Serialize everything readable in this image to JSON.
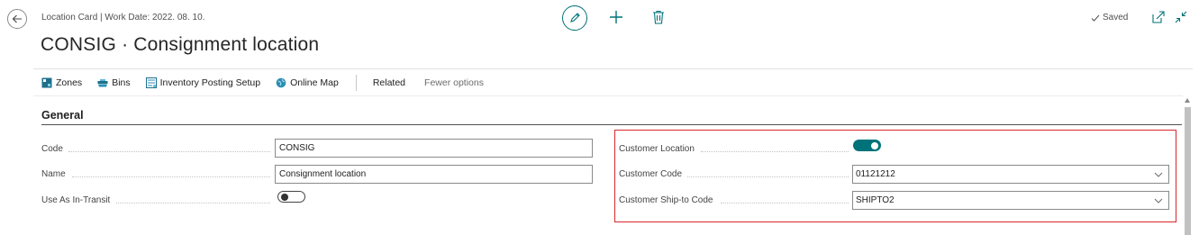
{
  "header": {
    "breadcrumb": "Location Card | Work Date: 2022. 08. 10.",
    "title": "CONSIG · Consignment location",
    "saved_label": "Saved"
  },
  "actions": [
    {
      "label": "Zones",
      "icon": "zones-icon"
    },
    {
      "label": "Bins",
      "icon": "bins-icon"
    },
    {
      "label": "Inventory Posting Setup",
      "icon": "inventory-posting-setup-icon"
    },
    {
      "label": "Online Map",
      "icon": "online-map-icon"
    }
  ],
  "action_related": "Related",
  "action_fewer": "Fewer options",
  "section": {
    "title": "General"
  },
  "fields": {
    "code": {
      "label": "Code",
      "value": "CONSIG"
    },
    "name": {
      "label": "Name",
      "value": "Consignment location"
    },
    "use_as_in_transit": {
      "label": "Use As In-Transit",
      "value": false
    },
    "customer_location": {
      "label": "Customer Location",
      "value": true
    },
    "customer_code": {
      "label": "Customer Code",
      "value": "01121212"
    },
    "customer_ship_to_code": {
      "label": "Customer Ship-to Code",
      "value": "SHIPTO2"
    }
  },
  "colors": {
    "accent": "#00727a",
    "highlight": "#d9262c"
  }
}
